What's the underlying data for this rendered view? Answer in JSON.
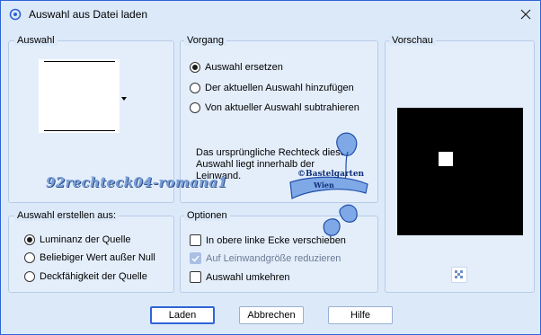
{
  "window": {
    "title": "Auswahl aus Datei laden"
  },
  "groups": {
    "selection": {
      "label": "Auswahl"
    },
    "process": {
      "label": "Vorgang"
    },
    "preview": {
      "label": "Vorschau"
    },
    "create_from": {
      "label": "Auswahl erstellen aus:"
    },
    "options": {
      "label": "Optionen"
    }
  },
  "process": {
    "options": [
      {
        "label": "Auswahl ersetzen",
        "checked": true
      },
      {
        "label": "Der aktuellen Auswahl hinzufügen",
        "checked": false
      },
      {
        "label": "Von aktueller Auswahl subtrahieren",
        "checked": false
      }
    ],
    "info_text": "Das ursprüngliche Rechteck diese Auswahl liegt innerhalb der Leinwand."
  },
  "create_from": {
    "options": [
      {
        "label": "Luminanz der Quelle",
        "checked": true
      },
      {
        "label": "Beliebiger Wert außer Null",
        "checked": false
      },
      {
        "label": "Deckfähigkeit der Quelle",
        "checked": false
      }
    ]
  },
  "options": {
    "items": [
      {
        "label": "In obere linke Ecke verschieben",
        "checked": false,
        "disabled": false
      },
      {
        "label": "Auf Leinwandgröße reduzieren",
        "checked": true,
        "disabled": true
      },
      {
        "label": "Auswahl umkehren",
        "checked": false,
        "disabled": false
      }
    ]
  },
  "buttons": {
    "load": "Laden",
    "cancel": "Abbrechen",
    "help": "Hilfe"
  },
  "watermark": {
    "text": "92rechteck04-romana1",
    "stamp_line1": "©Bastelgarten",
    "stamp_line2": "Wien"
  },
  "colors": {
    "accent": "#2f64d6",
    "dialog_bg": "#dce9f9",
    "group_bg": "#e4eefb",
    "preview_bg": "#000000",
    "preview_selection": "#ffffff"
  },
  "icons": {
    "app": "app-icon",
    "close": "close-icon",
    "dropdown": "chevron-down-icon",
    "zoom": "checkerboard-icon"
  }
}
